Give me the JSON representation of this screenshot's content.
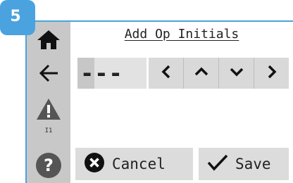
{
  "step_badge": "5",
  "title": "Add Op Initials",
  "sidebar": {
    "small_label": "I1",
    "icons": [
      "home-icon",
      "back-arrow-icon",
      "warning-icon",
      "help-icon"
    ]
  },
  "initials": {
    "value": "---"
  },
  "arrows": {
    "icons": [
      "chevron-left-icon",
      "chevron-up-icon",
      "chevron-down-icon",
      "chevron-right-icon"
    ]
  },
  "actions": {
    "cancel_label": "Cancel",
    "save_label": "Save"
  },
  "colors": {
    "accent": "#4aa3df",
    "sidebar_bg": "#c8c8c8",
    "button_bg": "#dcdcdc",
    "icon_dark": "#222222"
  }
}
